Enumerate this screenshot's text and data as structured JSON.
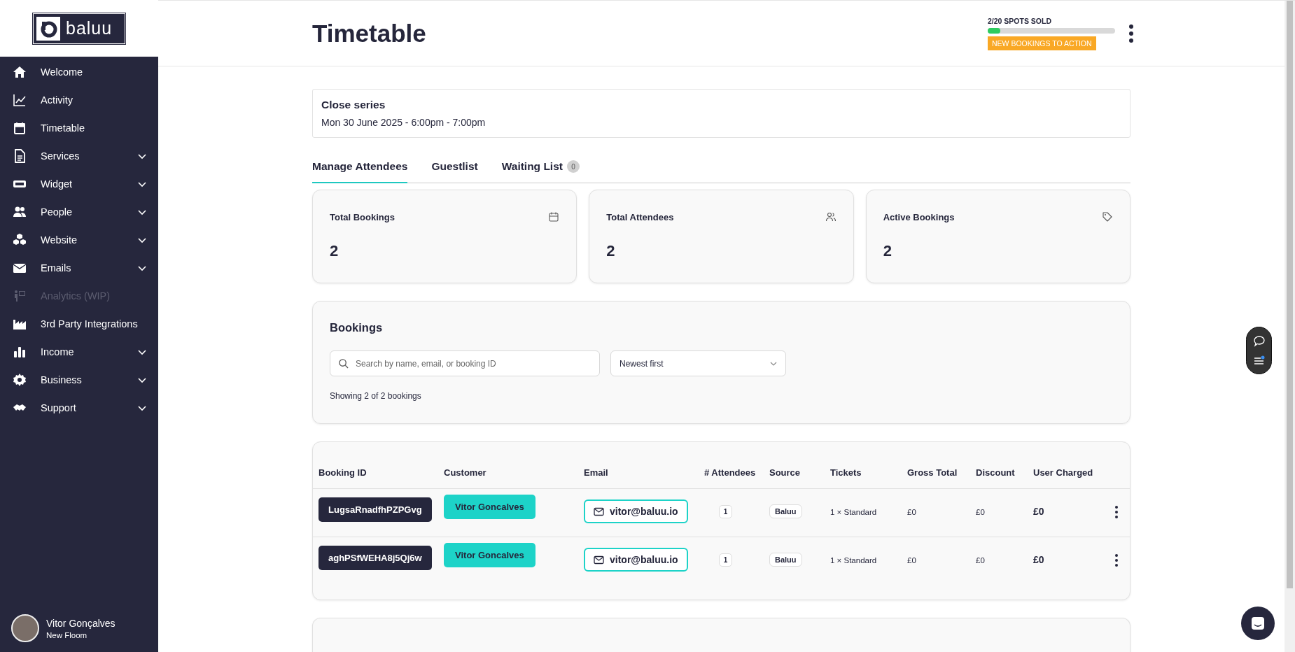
{
  "sidebar": {
    "logo": "baluu",
    "items": [
      {
        "label": "Welcome",
        "expandable": false,
        "disabled": false
      },
      {
        "label": "Activity",
        "expandable": false,
        "disabled": false
      },
      {
        "label": "Timetable",
        "expandable": false,
        "disabled": false
      },
      {
        "label": "Services",
        "expandable": true,
        "disabled": false
      },
      {
        "label": "Widget",
        "expandable": true,
        "disabled": false
      },
      {
        "label": "People",
        "expandable": true,
        "disabled": false
      },
      {
        "label": "Website",
        "expandable": true,
        "disabled": false
      },
      {
        "label": "Emails",
        "expandable": true,
        "disabled": false
      },
      {
        "label": "Analytics (WIP)",
        "expandable": false,
        "disabled": true
      },
      {
        "label": "3rd Party Integrations",
        "expandable": false,
        "disabled": false
      },
      {
        "label": "Income",
        "expandable": true,
        "disabled": false
      },
      {
        "label": "Business",
        "expandable": true,
        "disabled": false
      },
      {
        "label": "Support",
        "expandable": true,
        "disabled": false
      }
    ],
    "user": {
      "name": "Vitor Gonçalves",
      "org": "New Floom"
    }
  },
  "header": {
    "title": "Timetable",
    "spots": {
      "label": "2/20 SPOTS SOLD",
      "level": 0.1
    },
    "badge": "NEW BOOKINGS TO ACTION"
  },
  "series": {
    "title": "Close series",
    "date": "Mon 30 June 2025 - 6:00pm - 7:00pm"
  },
  "tabs": [
    {
      "label": "Manage Attendees",
      "selected": true
    },
    {
      "label": "Guestlist",
      "selected": false
    },
    {
      "label": "Waiting List",
      "selected": false,
      "count": "0"
    }
  ],
  "stats": [
    {
      "label": "Total Bookings",
      "value": "2"
    },
    {
      "label": "Total Attendees",
      "value": "2"
    },
    {
      "label": "Active Bookings",
      "value": "2"
    }
  ],
  "bookings": {
    "title": "Bookings",
    "search": {
      "placeholder": "Search by name, email, or booking ID"
    },
    "sort": "Newest first",
    "showing": "Showing 2 of 2 bookings"
  },
  "table": {
    "columns": [
      "Booking ID",
      "Customer",
      "Email",
      "# Attendees",
      "Source",
      "Tickets",
      "Gross Total",
      "Discount",
      "User Charged"
    ],
    "rows": [
      {
        "id": "LugsaRnadfhPZPGvg",
        "customer": "Vitor Goncalves",
        "email": "vitor@baluu.io",
        "attendees": "1",
        "source": "Baluu",
        "tickets": "1 × Standard",
        "gross": "£0",
        "discount": "£0",
        "charged": "£0"
      },
      {
        "id": "aghPSfWEHA8j5Qj6w",
        "customer": "Vitor Goncalves",
        "email": "vitor@baluu.io",
        "attendees": "1",
        "source": "Baluu",
        "tickets": "1 × Standard",
        "gross": "£0",
        "discount": "£0",
        "charged": "£0"
      }
    ]
  }
}
